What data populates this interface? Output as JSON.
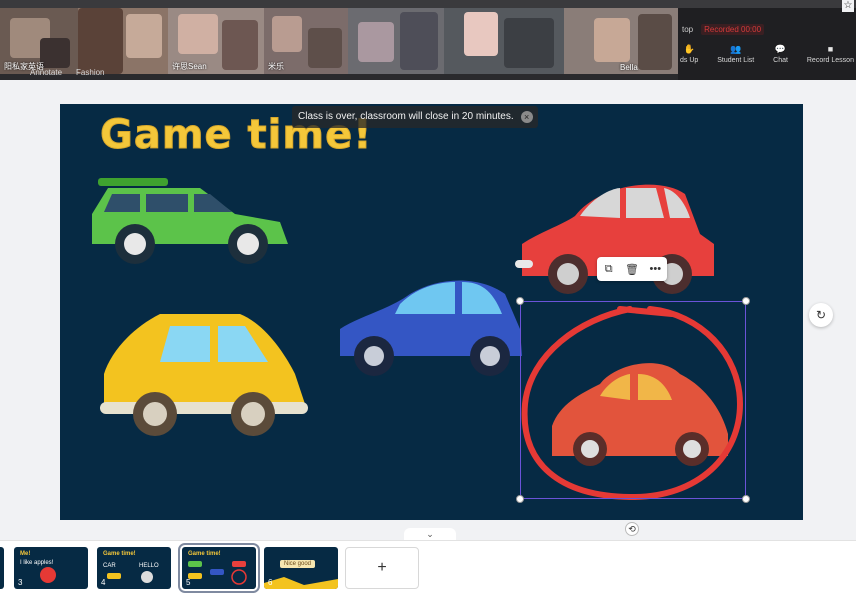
{
  "video": {
    "names": [
      "阳私家英语",
      "许思Sean",
      "米乐",
      "Bella"
    ],
    "strip_labels": [
      "Annotate",
      "Fashion"
    ]
  },
  "zoom": {
    "top_label": "top",
    "recording_label": "Recorded 00:00",
    "actions": [
      {
        "label": "ds Up",
        "icon": "raise-hand-icon"
      },
      {
        "label": "Student List",
        "icon": "people-icon"
      },
      {
        "label": "Chat",
        "icon": "chat-icon"
      },
      {
        "label": "Record Lesson",
        "icon": "camera-icon"
      }
    ]
  },
  "slide": {
    "title": "Game time!",
    "colors": {
      "background": "#062a44",
      "title": "#f4c73a"
    }
  },
  "notice": {
    "text": "Class is over, classroom will close in 20 minutes."
  },
  "selection_tools": [
    "copy-icon",
    "trash-icon",
    "more-icon"
  ],
  "filmstrip": {
    "thumbnails": [
      {
        "num": "3",
        "title": "Me!",
        "sub": "I like apples!"
      },
      {
        "num": "4",
        "title": "Game time!",
        "sub_left": "CAR",
        "sub_right": "HELLO"
      },
      {
        "num": "5",
        "title": "Game time!"
      },
      {
        "num": "6",
        "badge": "Nice good"
      }
    ],
    "add_label": "+"
  }
}
